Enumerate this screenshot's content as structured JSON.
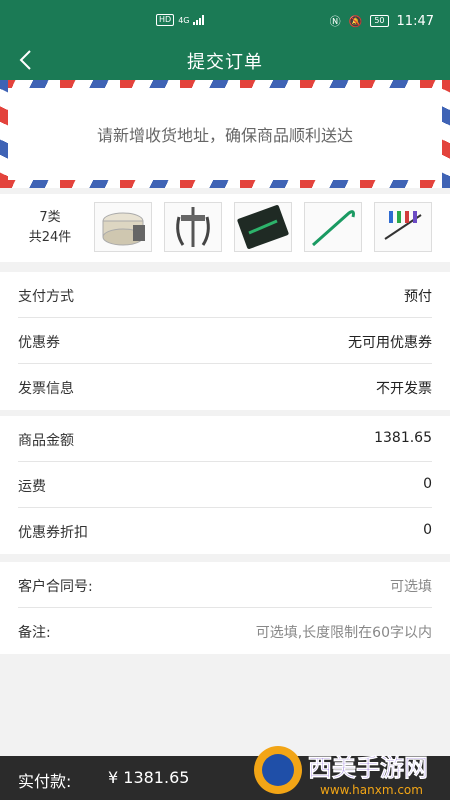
{
  "status_bar": {
    "net_badge": "HD",
    "net_type": "4G",
    "time": "11:47",
    "battery": "50"
  },
  "header": {
    "title": "提交订单"
  },
  "address": {
    "prompt": "请新增收货地址，确保商品顺利送达"
  },
  "products": {
    "kinds": "7类",
    "count": "共24件",
    "thumbs": [
      "sanding-disc-icon",
      "gear-puller-icon",
      "tool-set-icon",
      "pry-bar-icon",
      "screwdriver-set-icon"
    ]
  },
  "order_info": [
    {
      "label": "支付方式",
      "value": "预付"
    },
    {
      "label": "优惠券",
      "value": "无可用优惠券"
    },
    {
      "label": "发票信息",
      "value": "不开发票"
    }
  ],
  "amounts": [
    {
      "label": "商品金额",
      "value": "1381.65"
    },
    {
      "label": "运费",
      "value": "0"
    },
    {
      "label": "优惠券折扣",
      "value": "0"
    }
  ],
  "extra": {
    "contract_label": "客户合同号:",
    "contract_placeholder": "可选填",
    "note_label": "备注:",
    "note_placeholder": "可选填,长度限制在60字以内"
  },
  "footer": {
    "total_label": "实付款:",
    "total_value": "¥ 1381.65",
    "watermark_text": "西美手游网",
    "watermark_url": "www.hanxm.com"
  },
  "colors": {
    "primary": "#1b7a55",
    "footer_bg": "#2b2b2b",
    "stripe_red": "#e3433c",
    "stripe_blue": "#3f63b5"
  }
}
